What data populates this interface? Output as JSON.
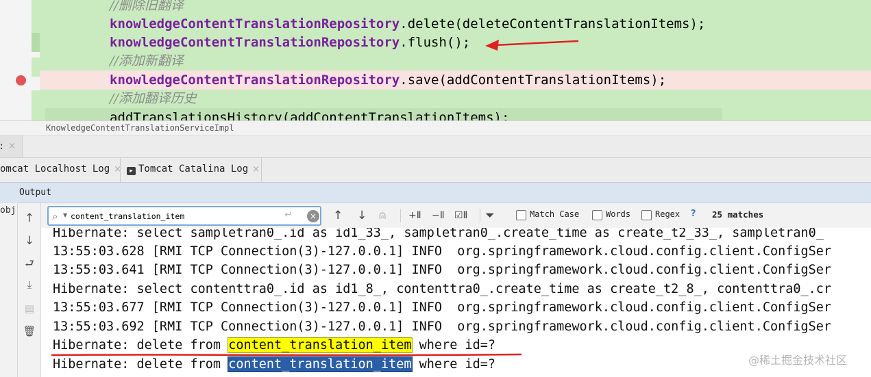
{
  "editor": {
    "lines": [
      {
        "kind": "comment",
        "text": "//删除旧翻译"
      },
      {
        "kind": "call",
        "field": "knowledgeContentTranslationRepository",
        "rest": ".delete(deleteContentTranslationItems);"
      },
      {
        "kind": "call",
        "field": "knowledgeContentTranslationRepository",
        "rest": ".flush();"
      },
      {
        "kind": "comment",
        "text": "//添加新翻译"
      },
      {
        "kind": "call",
        "field": "knowledgeContentTranslationRepository",
        "rest": ".save(addContentTranslationItems);"
      },
      {
        "kind": "comment",
        "text": "//添加翻译历史"
      },
      {
        "kind": "plain",
        "text": "addTranslationsHistory(addContentTranslationItems);"
      }
    ],
    "breakpoint_line": 5,
    "arrow_color": "#e02020"
  },
  "breadcrumb": "KnowledgeContentTranslationServiceImpl",
  "service_tab": {
    "label": ":",
    "close": "×"
  },
  "log_tabs": [
    {
      "label": "omcat Localhost Log",
      "close": "×"
    },
    {
      "label": "Tomcat Catalina Log",
      "close": "×"
    }
  ],
  "output": {
    "title": "Output",
    "left_stub": "obj"
  },
  "search": {
    "value": "content_translation_item",
    "match_case": "Match Case",
    "words": "Words",
    "regex": "Regex",
    "help": "?",
    "matches": "25 matches"
  },
  "console_lines": [
    [
      "Hibernate: select sampletran0_.id as id1_33_, sampletran0_.create_time as create_t2_33_, sampletran0_"
    ],
    [
      "13:55:03.628 [RMI TCP Connection(3)-127.0.0.1] INFO  org.springframework.cloud.config.client.ConfigSer"
    ],
    [
      "13:55:03.641 [RMI TCP Connection(3)-127.0.0.1] INFO  org.springframework.cloud.config.client.ConfigSer"
    ],
    [
      "Hibernate: select contenttra0_.id as id1_8_, contenttra0_.create_time as create_t2_8_, contenttra0_.cr"
    ],
    [
      "13:55:03.677 [RMI TCP Connection(3)-127.0.0.1] INFO  org.springframework.cloud.config.client.ConfigSer"
    ],
    [
      "13:55:03.692 [RMI TCP Connection(3)-127.0.0.1] INFO  org.springframework.cloud.config.client.ConfigSer"
    ],
    [
      "Hibernate: delete from ",
      "content_translation_item",
      " where id=?"
    ],
    [
      "Hibernate: delete from ",
      "content_translation_item",
      " where id=?"
    ]
  ],
  "highlight_colors": {
    "match": "#ffff00",
    "current": "#2b5ea8",
    "annotation": "#e02020"
  },
  "watermark": "@稀土掘金技术社区"
}
